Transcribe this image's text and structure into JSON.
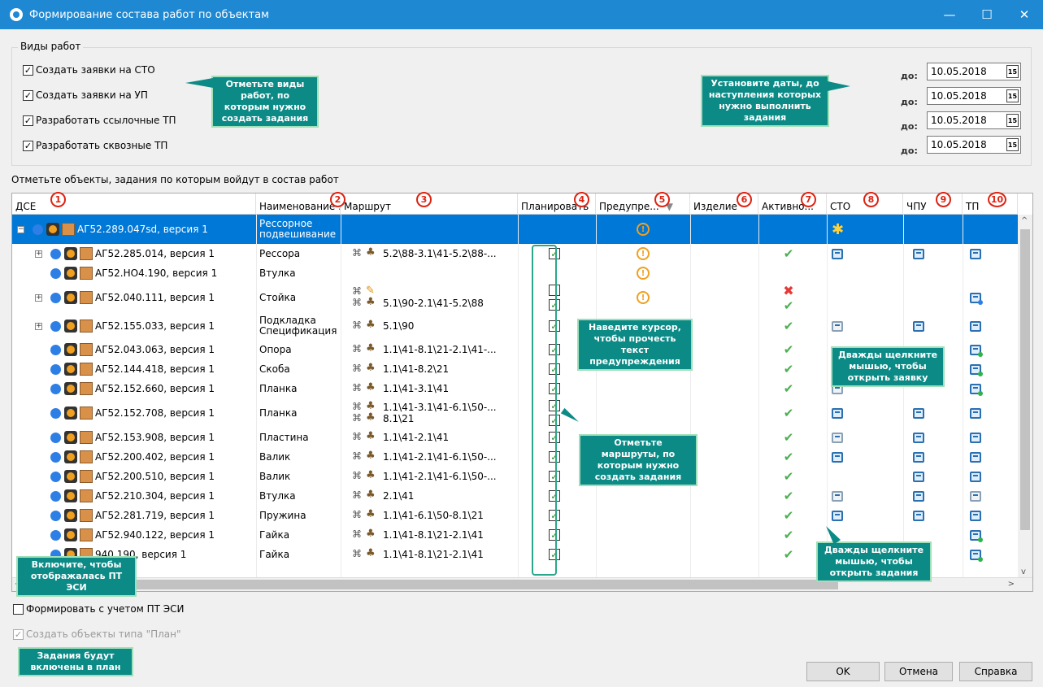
{
  "window": {
    "title": "Формирование состава работ по объектам",
    "minimize": "—",
    "maximize": "☐",
    "close": "✕"
  },
  "work_types": {
    "legend": "Виды работ",
    "items": [
      {
        "label": "Создать заявки на СТО",
        "checked": true
      },
      {
        "label": "Создать заявки на УП",
        "checked": true
      },
      {
        "label": "Разработать ссылочные ТП",
        "checked": true
      },
      {
        "label": "Разработать сквозные ТП",
        "checked": true
      }
    ],
    "due_label": "до:",
    "dates": [
      "10.05.2018",
      "10.05.2018",
      "10.05.2018",
      "10.05.2018"
    ],
    "calendar_glyph": "15"
  },
  "hints": {
    "work_types": "Отметьте виды работ, по которым нужно создать задания",
    "dates": "Установите даты, до наступления которых нужно выполнить задания",
    "warning": "Наведите курсор, чтобы прочесть текст предупреждения",
    "open_request": "Дважды щелкните мышью, чтобы открыть заявку",
    "routes": "Отметьте маршруты, по которым нужно создать задания",
    "pt_esi": "Включите, чтобы отображалась ПТ ЭСИ",
    "open_tasks": "Дважды щелкните мышью, чтобы открыть задания",
    "plan": "Задания будут включены в план"
  },
  "objects_label": "Отметьте объекты, задания по которым войдут в состав работ",
  "columns": [
    {
      "label": "ДСЕ",
      "badge": "1"
    },
    {
      "label": "Наименование ...",
      "badge": "2"
    },
    {
      "label": "Маршрут",
      "badge": "3"
    },
    {
      "label": "Планировать",
      "badge": "4"
    },
    {
      "label": "Предупре...",
      "badge": "5"
    },
    {
      "label": "Изделие",
      "badge": "6"
    },
    {
      "label": "Активно...",
      "badge": "7"
    },
    {
      "label": "СТО",
      "badge": "8"
    },
    {
      "label": "ЧПУ",
      "badge": "9"
    },
    {
      "label": "ТП",
      "badge": "10"
    }
  ],
  "rows": [
    {
      "dse": "АГ52.289.047sd, версия 1",
      "name": "Рессорное подвешивание",
      "route": "",
      "plan": [],
      "warn": true,
      "active": [],
      "sto": "star",
      "chpu": "",
      "tp": ""
    },
    {
      "dse": "АГ52.285.014, версия 1",
      "name": "Рессора",
      "route": "5.2\\88-3.1\\41-5.2\\88-...",
      "plan": [
        true
      ],
      "warn": true,
      "active": [
        "ok"
      ],
      "sto": "doc",
      "chpu": "doc",
      "tp": "doc"
    },
    {
      "dse": "АГ52.НО4.190, версия 1",
      "name": "Втулка",
      "route": "",
      "plan": [],
      "warn": true,
      "active": [],
      "sto": "",
      "chpu": "",
      "tp": ""
    },
    {
      "dse": "АГ52.040.111, версия 1",
      "name": "Стойка",
      "route": "5.1\\90-2.1\\41-5.2\\88",
      "plan": [
        false,
        true
      ],
      "warn": true,
      "active": [
        "x",
        "ok"
      ],
      "sto": "",
      "chpu": "",
      "tp": "doc-blu"
    },
    {
      "dse": "АГ52.155.033, версия 1",
      "name": "Подкладка Спецификация",
      "route": "5.1\\90",
      "plan": [
        true
      ],
      "warn": false,
      "active": [
        "ok"
      ],
      "sto": "doc-grey",
      "chpu": "doc",
      "tp": "doc"
    },
    {
      "dse": "АГ52.043.063, версия 1",
      "name": "Опора",
      "route": "1.1\\41-8.1\\21-2.1\\41-...",
      "plan": [
        true
      ],
      "warn": false,
      "active": [
        "ok"
      ],
      "sto": "",
      "chpu": "",
      "tp": "doc-grn"
    },
    {
      "dse": "АГ52.144.418, версия 1",
      "name": "Скоба",
      "route": "1.1\\41-8.2\\21",
      "plan": [
        true
      ],
      "warn": false,
      "active": [
        "ok"
      ],
      "sto": "",
      "chpu": "",
      "tp": "doc-grn"
    },
    {
      "dse": "АГ52.152.660, версия 1",
      "name": "Планка",
      "route": "1.1\\41-3.1\\41",
      "plan": [
        true
      ],
      "warn": false,
      "active": [
        "ok"
      ],
      "sto": "doc-grey",
      "chpu": "",
      "tp": "doc-grn"
    },
    {
      "dse": "АГ52.152.708, версия 1",
      "name": "Планка",
      "route": "1.1\\41-3.1\\41-6.1\\50-...",
      "route2": "8.1\\21",
      "plan": [
        true,
        true
      ],
      "warn": false,
      "active": [
        "ok"
      ],
      "sto": "doc",
      "chpu": "doc",
      "tp": "doc"
    },
    {
      "dse": "АГ52.153.908, версия 1",
      "name": "Пластина",
      "route": "1.1\\41-2.1\\41",
      "plan": [
        true
      ],
      "warn": false,
      "active": [
        "ok"
      ],
      "sto": "doc-grey",
      "chpu": "doc",
      "tp": "doc"
    },
    {
      "dse": "АГ52.200.402, версия 1",
      "name": "Валик",
      "route": "1.1\\41-2.1\\41-6.1\\50-...",
      "plan": [
        true
      ],
      "warn": false,
      "active": [
        "ok"
      ],
      "sto": "doc",
      "chpu": "doc",
      "tp": "doc"
    },
    {
      "dse": "АГ52.200.510, версия 1",
      "name": "Валик",
      "route": "1.1\\41-2.1\\41-6.1\\50-...",
      "plan": [
        true
      ],
      "warn": false,
      "active": [
        "ok"
      ],
      "sto": "",
      "chpu": "doc",
      "tp": "doc"
    },
    {
      "dse": "АГ52.210.304, версия 1",
      "name": "Втулка",
      "route": "2.1\\41",
      "plan": [
        true
      ],
      "warn": false,
      "active": [
        "ok"
      ],
      "sto": "doc-grey",
      "chpu": "doc",
      "tp": "doc-grey"
    },
    {
      "dse": "АГ52.281.719, версия 1",
      "name": "Пружина",
      "route": "1.1\\41-6.1\\50-8.1\\21",
      "plan": [
        true
      ],
      "warn": false,
      "active": [
        "ok"
      ],
      "sto": "doc",
      "chpu": "doc",
      "tp": "doc"
    },
    {
      "dse": "АГ52.940.122, версия 1",
      "name": "Гайка",
      "route": "1.1\\41-8.1\\21-2.1\\41",
      "plan": [
        true
      ],
      "warn": false,
      "active": [
        "ok"
      ],
      "sto": "",
      "chpu": "",
      "tp": "doc-grn"
    },
    {
      "dse": "940.190, версия 1",
      "name": "Гайка",
      "route": "1.1\\41-8.1\\21-2.1\\41",
      "plan": [
        true
      ],
      "warn": false,
      "active": [
        "ok"
      ],
      "sto": "",
      "chpu": "",
      "tp": "doc-grn"
    }
  ],
  "options": [
    {
      "label": "Формировать с учетом ПТ ЭСИ",
      "checked": false,
      "disabled": false
    },
    {
      "label": "Создать объекты типа \"План\"",
      "checked": true,
      "disabled": true
    }
  ],
  "buttons": {
    "ok": "OK",
    "cancel": "Отмена",
    "help": "Справка"
  }
}
